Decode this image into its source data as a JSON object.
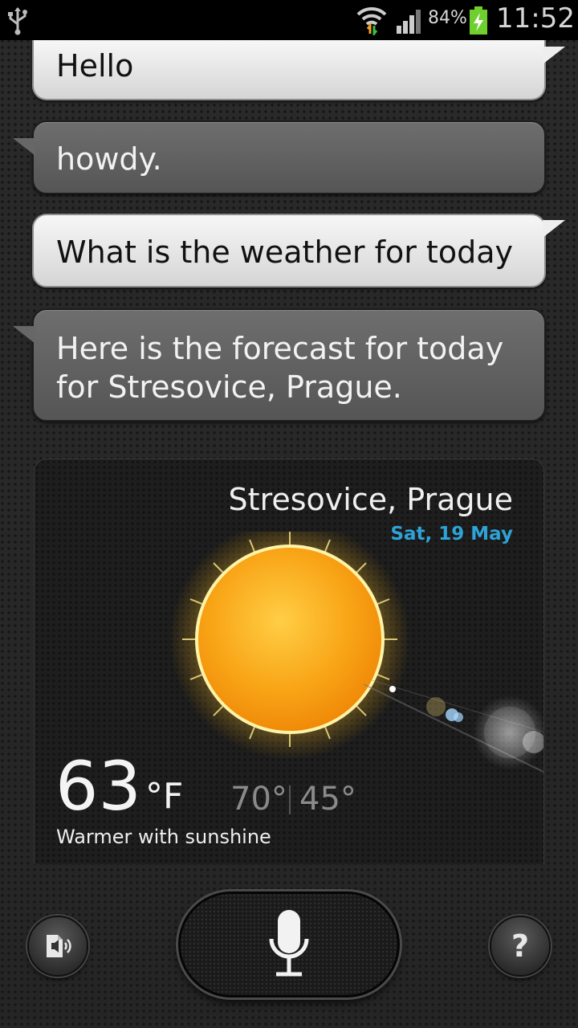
{
  "status_bar": {
    "battery_percent": "84%",
    "time": "11:52"
  },
  "conversation": [
    {
      "speaker": "user",
      "text": "Hello"
    },
    {
      "speaker": "assistant",
      "text": "howdy."
    },
    {
      "speaker": "user",
      "text": "What is the weather for today"
    },
    {
      "speaker": "assistant",
      "text": "Here is the forecast for today for Stresovice, Prague."
    }
  ],
  "weather": {
    "location": "Stresovice, Prague",
    "date": "Sat, 19 May",
    "temperature": "63",
    "unit": "°F",
    "high": "70°",
    "low": "45°",
    "condition": "Warmer with sunshine",
    "icon": "sun-icon"
  },
  "controls": {
    "tts_icon": "speaker-tts-icon",
    "mic_icon": "microphone-icon",
    "help_label": "?"
  },
  "colors": {
    "date_accent": "#2ea3d8",
    "user_bubble": "#e6e6e6",
    "assistant_bubble": "#616161"
  }
}
